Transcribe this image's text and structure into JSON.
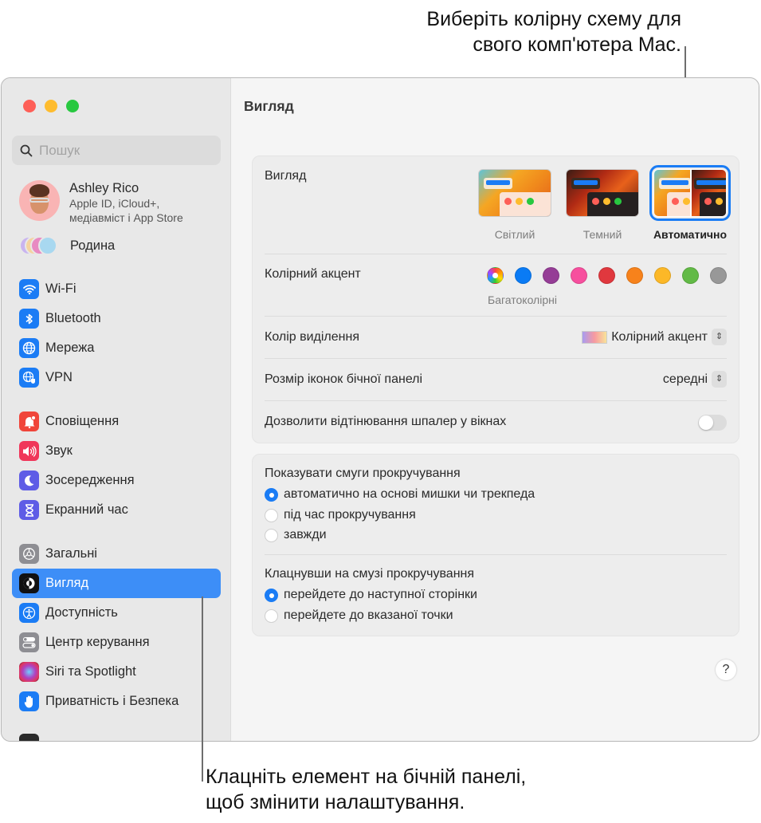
{
  "callouts": {
    "top_line1": "Виберіть колірну схему для",
    "top_line2": "свого комп'ютера Mac.",
    "bottom_line1": "Клацніть елемент на бічній панелі,",
    "bottom_line2": "щоб змінити налаштування."
  },
  "sidebar": {
    "search_placeholder": "Пошук",
    "profile": {
      "name": "Ashley Rico",
      "sub1": "Apple ID, iCloud+,",
      "sub2": "медіавміст і App Store"
    },
    "family_label": "Родина",
    "groups": [
      [
        {
          "label": "Wi-Fi",
          "icon": "wifi-icon",
          "color": "#1b7cf5"
        },
        {
          "label": "Bluetooth",
          "icon": "bluetooth-icon",
          "color": "#1b7cf5"
        },
        {
          "label": "Мережа",
          "icon": "globe-icon",
          "color": "#1b7cf5"
        },
        {
          "label": "VPN",
          "icon": "vpn-globe-icon",
          "color": "#1b7cf5"
        }
      ],
      [
        {
          "label": "Сповіщення",
          "icon": "bell-icon",
          "color": "#f0453a"
        },
        {
          "label": "Звук",
          "icon": "speaker-icon",
          "color": "#f0365a"
        },
        {
          "label": "Зосередження",
          "icon": "moon-icon",
          "color": "#5e5ce6"
        },
        {
          "label": "Екранний час",
          "icon": "hourglass-icon",
          "color": "#5e5ce6"
        }
      ],
      [
        {
          "label": "Загальні",
          "icon": "gear-icon",
          "color": "#8e8e93"
        },
        {
          "label": "Вигляд",
          "icon": "appearance-icon",
          "color": "#111111",
          "active": true
        },
        {
          "label": "Доступність",
          "icon": "accessibility-icon",
          "color": "#1b7cf5"
        },
        {
          "label": "Центр керування",
          "icon": "control-center-icon",
          "color": "#8e8e93"
        },
        {
          "label": "Siri та Spotlight",
          "icon": "siri-icon",
          "color": "#7a3b8f"
        },
        {
          "label": "Приватність і Безпека",
          "icon": "hand-icon",
          "color": "#1b7cf5"
        }
      ]
    ]
  },
  "main": {
    "title": "Вигляд",
    "appearance": {
      "label": "Вигляд",
      "options": [
        {
          "label": "Світлий",
          "selected": false
        },
        {
          "label": "Темний",
          "selected": false
        },
        {
          "label": "Автоматично",
          "selected": true
        }
      ]
    },
    "accent": {
      "label": "Колірний акцент",
      "caption": "Багатоколірні",
      "colors": [
        "multicolor",
        "#0a7bf5",
        "#953d96",
        "#f74f9e",
        "#e0383e",
        "#f7821b",
        "#fcb827",
        "#62ba46",
        "#989898"
      ],
      "selected": "multicolor"
    },
    "highlight": {
      "label": "Колір виділення",
      "value": "Колірний акцент"
    },
    "icon_size": {
      "label": "Розмір іконок бічної панелі",
      "value": "середні"
    },
    "wallpaper_tinting": {
      "label": "Дозволити відтінювання шпалер у вікнах",
      "enabled": false
    },
    "scrollbars": {
      "title": "Показувати смуги прокручування",
      "options": [
        {
          "label": "автоматично на основі мишки чи трекпеда",
          "selected": true
        },
        {
          "label": "під час прокручування",
          "selected": false
        },
        {
          "label": "завжди",
          "selected": false
        }
      ]
    },
    "click_scrollbar": {
      "title": "Клацнувши на смузі прокручування",
      "options": [
        {
          "label": "перейдете до наступної сторінки",
          "selected": true
        },
        {
          "label": "перейдете до вказаної точки",
          "selected": false
        }
      ]
    },
    "help": "?"
  }
}
